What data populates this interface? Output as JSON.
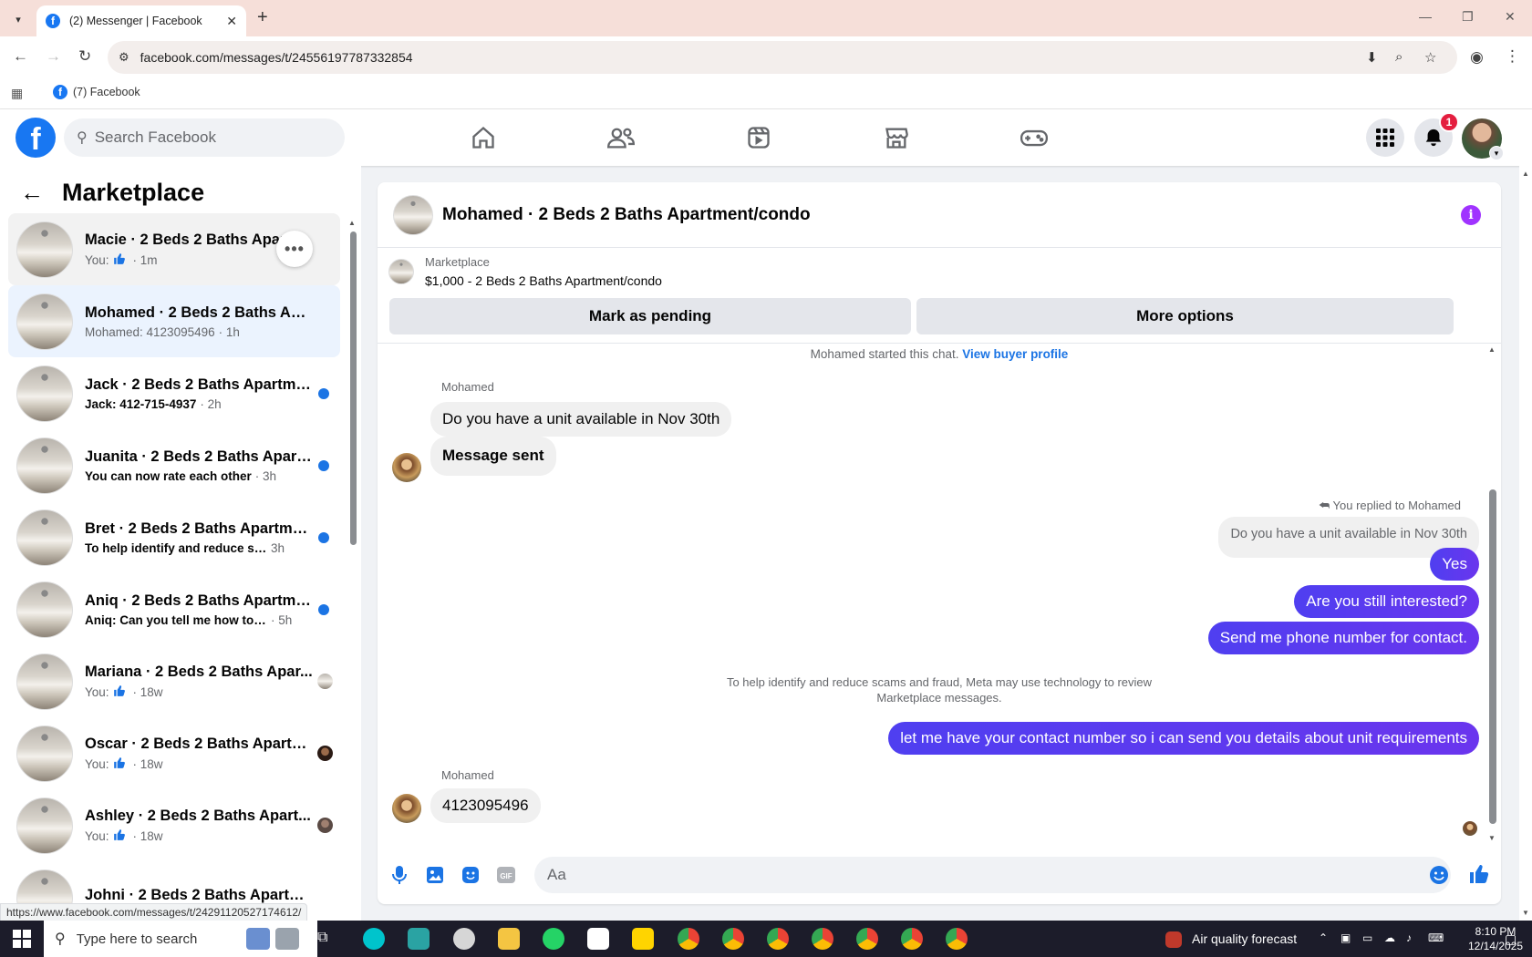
{
  "browser": {
    "tab_title": "(2) Messenger | Facebook",
    "url": "facebook.com/messages/t/24556197787332854",
    "bookmark": "(7) Facebook"
  },
  "header": {
    "search_placeholder": "Search Facebook",
    "notification_count": "1"
  },
  "sidebar": {
    "title": "Marketplace",
    "conversations": [
      {
        "name": "Macie · 2 Beds 2 Baths Apartment/condo",
        "prefix": "You:",
        "like": true,
        "preview": "",
        "time": "· 1m",
        "unread": false,
        "state": "hover",
        "indicator": "none"
      },
      {
        "name": "Mohamed · 2 Beds 2 Baths Apar...",
        "prefix": "",
        "like": false,
        "preview": "Mohamed: 4123095496",
        "time": "· 1h",
        "unread": false,
        "state": "active",
        "indicator": "none"
      },
      {
        "name": "Jack · 2 Beds 2 Baths Apartme...",
        "prefix": "",
        "like": false,
        "preview": "Jack: 412-715-4937",
        "time": "· 2h",
        "unread": true,
        "state": "",
        "indicator": "dot"
      },
      {
        "name": "Juanita · 2 Beds 2 Baths Apart...",
        "prefix": "",
        "like": false,
        "preview": "You can now rate each other",
        "time": "· 3h",
        "unread": true,
        "state": "",
        "indicator": "dot"
      },
      {
        "name": "Bret · 2 Beds 2 Baths Apartme...",
        "prefix": "",
        "like": false,
        "preview": "To help identify and reduce sca...",
        "time": "3h",
        "unread": true,
        "state": "",
        "indicator": "dot"
      },
      {
        "name": "Aniq · 2 Beds 2 Baths Apartme...",
        "prefix": "",
        "like": false,
        "preview": "Aniq: Can you tell me how to re...",
        "time": "· 5h",
        "unread": true,
        "state": "",
        "indicator": "dot"
      },
      {
        "name": "Mariana · 2 Beds 2 Baths Apar...",
        "prefix": "You:",
        "like": true,
        "preview": "",
        "time": "· 18w",
        "unread": false,
        "state": "",
        "indicator": "thumb"
      },
      {
        "name": "Oscar · 2 Beds 2 Baths Apartm...",
        "prefix": "You:",
        "like": true,
        "preview": "",
        "time": "· 18w",
        "unread": false,
        "state": "",
        "indicator": "avatar-dark"
      },
      {
        "name": "Ashley · 2 Beds 2 Baths Apart...",
        "prefix": "You:",
        "like": true,
        "preview": "",
        "time": "· 18w",
        "unread": false,
        "state": "",
        "indicator": "avatar-gray"
      },
      {
        "name": "Johni · 2 Beds 2 Baths Apartmen...",
        "prefix": "",
        "like": false,
        "preview": "",
        "time": "",
        "unread": false,
        "state": "",
        "indicator": "none"
      }
    ],
    "status_url": "https://www.facebook.com/messages/t/24291120527174612/"
  },
  "chat": {
    "title": "Mohamed · 2 Beds 2 Baths Apartment/condo",
    "listing_source": "Marketplace",
    "listing_title": "$1,000 - 2 Beds 2 Baths Apartment/condo",
    "mark_pending": "Mark as pending",
    "more_options": "More options",
    "started_text": "Mohamed started this chat.",
    "buyer_profile_link": "View buyer profile",
    "sender_name": "Mohamed",
    "msg_in_1": "Do you have a unit available in Nov 30th",
    "msg_in_2": "Message sent",
    "replied_label": "You replied to Mohamed",
    "quoted_text": "Do you have a unit available in Nov 30th",
    "msg_out_1": "Yes",
    "msg_out_2": "Are you still interested?",
    "msg_out_3": "Send me phone number for contact.",
    "notice_line1": "To help identify and reduce scams and fraud, Meta may use technology to review",
    "notice_line2": "Marketplace messages.",
    "msg_out_4": "let me have your contact number so i can send you details about unit requirements",
    "msg_in_3": "4123095496",
    "composer_placeholder": "Aa",
    "colors": {
      "outgoing": "#5b34f0",
      "accent": "#1b74e4"
    }
  },
  "taskbar": {
    "search_placeholder": "Type here to search",
    "weather": "Air quality forecast",
    "time": "8:10 PM",
    "date": "12/14/2025"
  }
}
